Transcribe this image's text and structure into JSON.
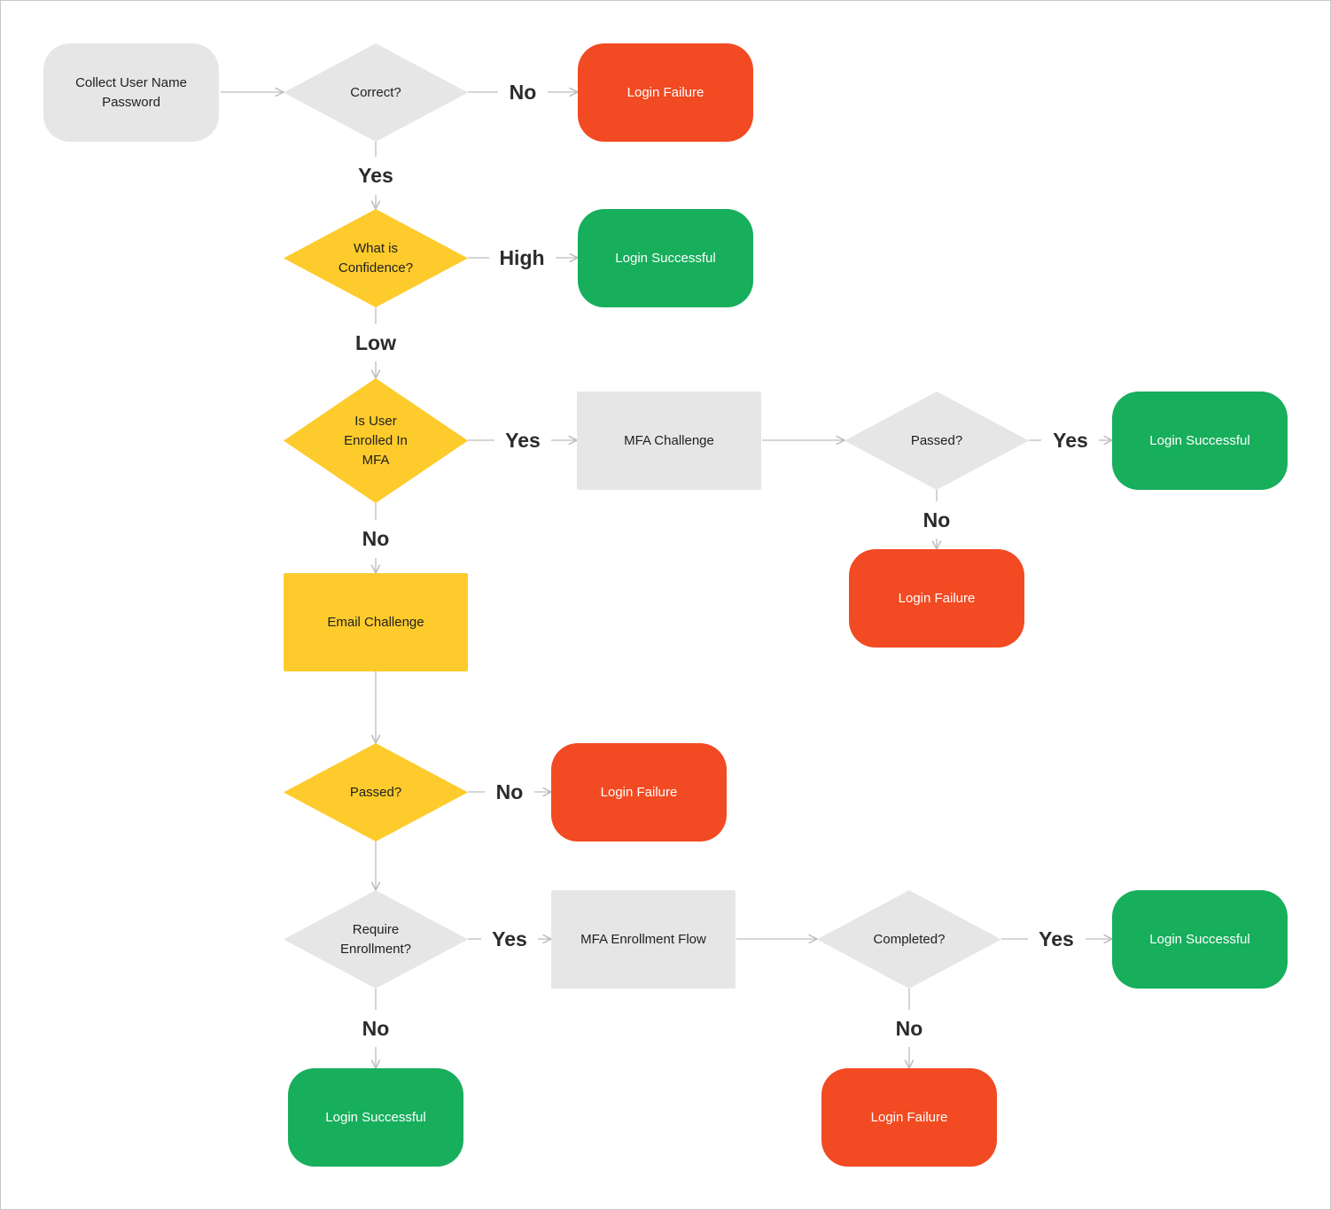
{
  "colors": {
    "neutral": "#e6e6e6",
    "decision_yellow": "#fdcb2c",
    "success": "#17ae5c",
    "failure": "#f24a22",
    "edge": "#bdbdbd",
    "text_dark": "#1f1f1f",
    "text_light": "#ffffff"
  },
  "nodes": [
    {
      "id": "collect",
      "shape": "rounded",
      "style": "neutral",
      "lines": [
        "Collect User Name",
        "Password"
      ]
    },
    {
      "id": "correct",
      "shape": "diamond",
      "style": "neutral",
      "lines": [
        "Correct?"
      ]
    },
    {
      "id": "fail1",
      "shape": "rounded",
      "style": "failure",
      "lines": [
        "Login Failure"
      ]
    },
    {
      "id": "confidence",
      "shape": "diamond",
      "style": "decision_yellow",
      "lines": [
        "What is",
        "Confidence?"
      ]
    },
    {
      "id": "success1",
      "shape": "rounded",
      "style": "success",
      "lines": [
        "Login Successful"
      ]
    },
    {
      "id": "enrolled",
      "shape": "diamond",
      "style": "decision_yellow",
      "lines": [
        "Is User",
        "Enrolled In",
        "MFA"
      ]
    },
    {
      "id": "mfa_challenge",
      "shape": "rect",
      "style": "neutral",
      "lines": [
        "MFA Challenge"
      ]
    },
    {
      "id": "mfa_passed",
      "shape": "diamond",
      "style": "neutral",
      "lines": [
        "Passed?"
      ]
    },
    {
      "id": "success2",
      "shape": "rounded",
      "style": "success",
      "lines": [
        "Login Successful"
      ]
    },
    {
      "id": "fail2",
      "shape": "rounded",
      "style": "failure",
      "lines": [
        "Login Failure"
      ]
    },
    {
      "id": "email_challenge",
      "shape": "rect",
      "style": "decision_yellow",
      "lines": [
        "Email Challenge"
      ]
    },
    {
      "id": "email_passed",
      "shape": "diamond",
      "style": "decision_yellow",
      "lines": [
        "Passed?"
      ]
    },
    {
      "id": "fail3",
      "shape": "rounded",
      "style": "failure",
      "lines": [
        "Login Failure"
      ]
    },
    {
      "id": "require_enroll",
      "shape": "diamond",
      "style": "neutral",
      "lines": [
        "Require",
        "Enrollment?"
      ]
    },
    {
      "id": "enroll_flow",
      "shape": "rect",
      "style": "neutral",
      "lines": [
        "MFA Enrollment Flow"
      ]
    },
    {
      "id": "completed",
      "shape": "diamond",
      "style": "neutral",
      "lines": [
        "Completed?"
      ]
    },
    {
      "id": "success3",
      "shape": "rounded",
      "style": "success",
      "lines": [
        "Login Successful"
      ]
    },
    {
      "id": "success4",
      "shape": "rounded",
      "style": "success",
      "lines": [
        "Login Successful"
      ]
    },
    {
      "id": "fail4",
      "shape": "rounded",
      "style": "failure",
      "lines": [
        "Login Failure"
      ]
    }
  ],
  "edges": [
    {
      "from": "collect",
      "to": "correct",
      "label": ""
    },
    {
      "from": "correct",
      "to": "fail1",
      "label": "No"
    },
    {
      "from": "correct",
      "to": "confidence",
      "label": "Yes"
    },
    {
      "from": "confidence",
      "to": "success1",
      "label": "High"
    },
    {
      "from": "confidence",
      "to": "enrolled",
      "label": "Low"
    },
    {
      "from": "enrolled",
      "to": "mfa_challenge",
      "label": "Yes"
    },
    {
      "from": "mfa_challenge",
      "to": "mfa_passed",
      "label": ""
    },
    {
      "from": "mfa_passed",
      "to": "success2",
      "label": "Yes"
    },
    {
      "from": "mfa_passed",
      "to": "fail2",
      "label": "No"
    },
    {
      "from": "enrolled",
      "to": "email_challenge",
      "label": "No"
    },
    {
      "from": "email_challenge",
      "to": "email_passed",
      "label": ""
    },
    {
      "from": "email_passed",
      "to": "fail3",
      "label": "No"
    },
    {
      "from": "email_passed",
      "to": "require_enroll",
      "label": ""
    },
    {
      "from": "require_enroll",
      "to": "enroll_flow",
      "label": "Yes"
    },
    {
      "from": "enroll_flow",
      "to": "completed",
      "label": ""
    },
    {
      "from": "completed",
      "to": "success3",
      "label": "Yes"
    },
    {
      "from": "completed",
      "to": "fail4",
      "label": "No"
    },
    {
      "from": "require_enroll",
      "to": "success4",
      "label": "No"
    }
  ]
}
